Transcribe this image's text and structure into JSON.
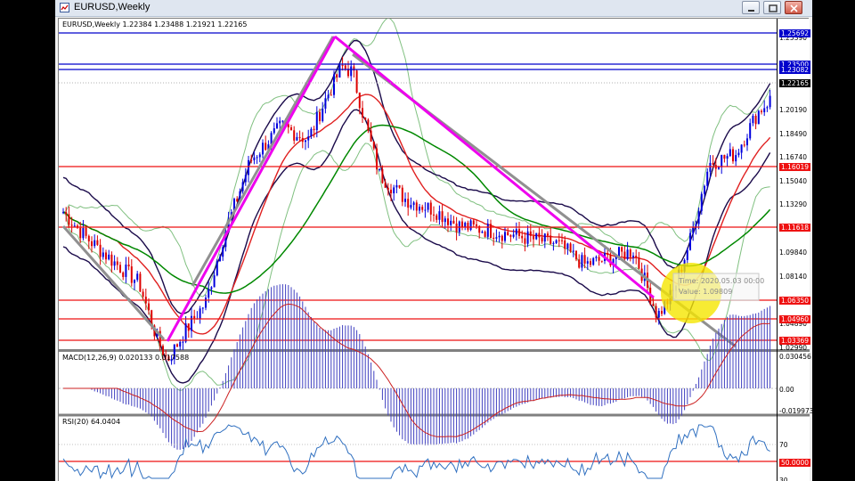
{
  "window": {
    "title": "EURUSD,Weekly",
    "app_icon": "chart-window-icon",
    "controls": [
      "minimize-icon",
      "restore-icon",
      "close-icon"
    ]
  },
  "chart": {
    "symbol_line": "EURUSD,Weekly  1.22384 1.23488 1.21921 1.22165",
    "current_price": "1.22165",
    "price_scale": [
      "1.25390",
      "1.20190",
      "1.18490",
      "1.16740",
      "1.15040",
      "1.13290",
      "1.09840",
      "1.08140",
      "1.04890",
      "1.02990"
    ],
    "horizontal_levels": [
      {
        "label": "1.25692",
        "color": "#0000cc"
      },
      {
        "label": "1.23500",
        "color": "#0000cc"
      },
      {
        "label": "1.23082",
        "color": "#0000cc"
      },
      {
        "label": "1.16019",
        "color": "#ee1111"
      },
      {
        "label": "1.11618",
        "color": "#ee1111"
      },
      {
        "label": "1.06350",
        "color": "#ee1111"
      },
      {
        "label": "1.04960",
        "color": "#ee1111"
      },
      {
        "label": "1.03369",
        "color": "#ee1111"
      }
    ],
    "tooltip": {
      "time": "Time: 2020.05.03 00:00",
      "value": "Value: 1.09809"
    },
    "highlight_color": "#f5e600",
    "trendline_color": "#ee00ee"
  },
  "macd": {
    "label": "MACD(12,26,9) 0.020133 0.017588",
    "scale": [
      "0.030456",
      "0.00",
      "-0.019973"
    ]
  },
  "rsi": {
    "label": "RSI(20) 64.0404",
    "scale": [
      "70",
      "50.0000",
      "30"
    ]
  },
  "colors": {
    "bull_candle": "#0000dd",
    "bear_candle": "#dd0000",
    "ma_red": "#e02020",
    "ma_green": "#008800",
    "bollinger_outer": "#80c080",
    "bollinger_inner": "#1a0a4a"
  }
}
